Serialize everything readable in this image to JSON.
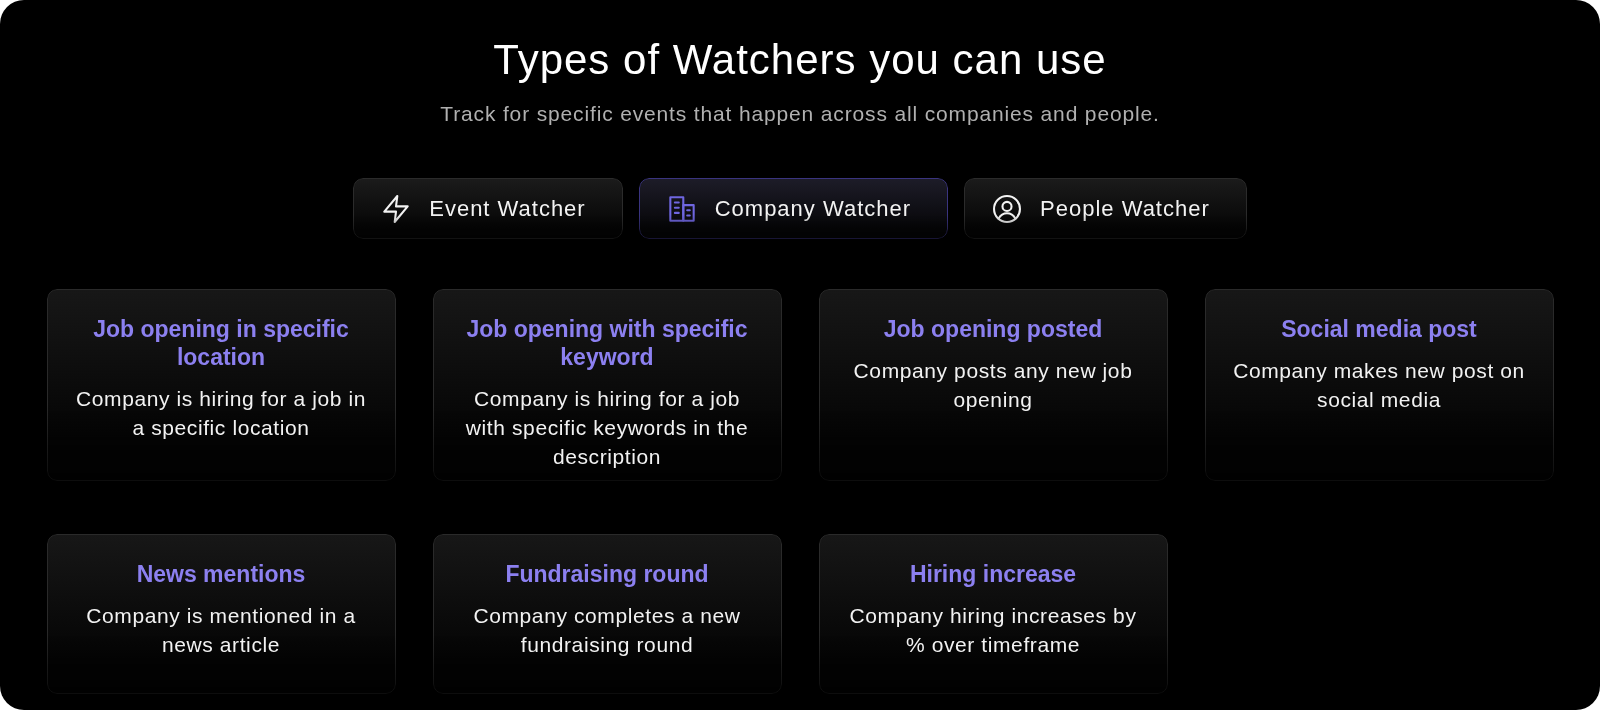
{
  "header": {
    "title": "Types of Watchers you can use",
    "subtitle": "Track for specific events that happen across all companies and people."
  },
  "tabs": [
    {
      "label": "Event Watcher",
      "kind": "event",
      "selected": false
    },
    {
      "label": "Company Watcher",
      "kind": "company",
      "selected": true
    },
    {
      "label": "People Watcher",
      "kind": "people",
      "selected": false
    }
  ],
  "cards": [
    {
      "title": "Job opening in specific location",
      "description": "Company is hiring for a job in a specific location"
    },
    {
      "title": "Job opening with specific keyword",
      "description": "Company is hiring for a job with specific keywords in the description"
    },
    {
      "title": "Job opening posted",
      "description": "Company posts any new job opening"
    },
    {
      "title": "Social media post",
      "description": "Company makes new post on social media"
    },
    {
      "title": "News mentions",
      "description": "Company is mentioned in a news article"
    },
    {
      "title": "Fundraising round",
      "description": "Company completes a new fundraising round"
    },
    {
      "title": "Hiring increase",
      "description": "Company hiring increases by % over timeframe"
    }
  ]
}
